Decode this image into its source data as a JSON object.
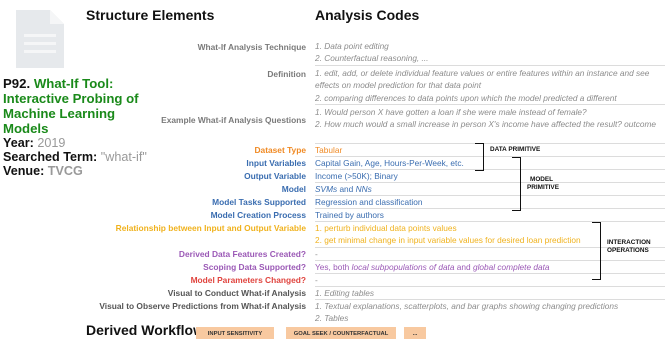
{
  "headers": {
    "left": "Structure Elements",
    "right": "Analysis Codes"
  },
  "paper": {
    "id": "P92.",
    "title": "What-If Tool: Interactive Probing of Machine Learning Models",
    "year_label": "Year:",
    "year": "2019",
    "search_label": "Searched Term:",
    "search_term": "\"what-if\"",
    "venue_label": "Venue:",
    "venue": "TVCG"
  },
  "rows": {
    "technique": {
      "label": "What-If Analysis Technique",
      "values": [
        "1. Data point editing",
        "2. Counterfactual reasoning, ..."
      ]
    },
    "definition": {
      "label": "Definition",
      "values": [
        "1. edit, add, or delete individual feature values or entire features within an instance and see effects on model prediction for that data point",
        "2. comparing differences to data points upon which the model predicted a different"
      ]
    },
    "questions": {
      "label": "Example What-if Analysis Questions",
      "values": [
        "1. Would person X have gotten a loan if she were male instead of female?",
        "2. How much would a small increase in person X's income have affected the result? outcome"
      ]
    },
    "dataset_type": {
      "label": "Dataset Type",
      "value": "Tabular"
    },
    "input_vars": {
      "label": "Input Variables",
      "value": "Capital Gain, Age, Hours-Per-Week, etc."
    },
    "output_var": {
      "label": "Output Variable",
      "value": "Income (>50K); Binary"
    },
    "model": {
      "label": "Model",
      "value_a": "SVMs",
      "value_mid": " and ",
      "value_b": "NNs"
    },
    "tasks": {
      "label": "Model Tasks Supported",
      "value": "Regression and classification"
    },
    "creation": {
      "label": "Model Creation Process",
      "value": "Trained by authors"
    },
    "relationship": {
      "label": "Relationship between Input and Output Variable",
      "values": [
        "1. perturb individual data points values",
        "2. get minimal change in input variable values for desired loan prediction"
      ]
    },
    "derived": {
      "label": "Derived Data Features Created?",
      "value": "-"
    },
    "scoping": {
      "label": "Scoping Data Supported?",
      "value_a": "Yes, both ",
      "value_b": "local subpopulations of data",
      "value_c": " and ",
      "value_d": "global complete data"
    },
    "params": {
      "label": "Model Parameters Changed?",
      "value": "-"
    },
    "visual_conduct": {
      "label": "Visual to Conduct What-if Analysis",
      "value": "1. Editing tables"
    },
    "visual_observe": {
      "label": "Visual to Observe Predictions from What-if Analysis",
      "values": [
        "1. Textual explanations, scatterplots, and bar graphs showing changing predictions",
        "2. Tables",
        "..."
      ]
    }
  },
  "brackets": {
    "data": "DATA PRIMITIVE",
    "model_1": "MODEL",
    "model_2": "PRIMITIVE",
    "interaction_1": "INTERACTION",
    "interaction_2": "OPERATIONS"
  },
  "workflows": {
    "title": "Derived Workflows",
    "chips": [
      "INPUT SENSITIVITY",
      "GOAL SEEK / COUNTERFACTUAL",
      "..."
    ]
  },
  "colors": {
    "title_green": "#1a8a1a",
    "orange": "#f08a24",
    "blue": "#3a6db0",
    "yellow": "#f0b21e",
    "purple": "#9b59b6",
    "red": "#e0443e",
    "chip": "#f8c9a0"
  }
}
